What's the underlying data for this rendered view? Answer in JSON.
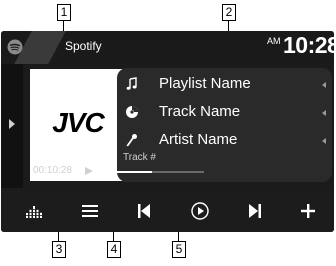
{
  "callouts": [
    "1",
    "2",
    "3",
    "4",
    "5"
  ],
  "header": {
    "source_icon": "spotify-icon",
    "source_label": "Spotify",
    "clock_ampm": "AM",
    "clock_time": "10:28"
  },
  "artwork": {
    "logo_text": "JVC"
  },
  "track_info": [
    {
      "icon": "music-note-icon",
      "text": "Playlist Name"
    },
    {
      "icon": "disc-icon",
      "text": "Track Name"
    },
    {
      "icon": "artist-icon",
      "text": "Artist Name"
    }
  ],
  "playback": {
    "track_label": "Track #",
    "elapsed": "00:10:28",
    "progress_fraction": 0.5
  },
  "controls": [
    {
      "icon": "equalizer-icon"
    },
    {
      "icon": "menu-icon"
    },
    {
      "icon": "previous-track-icon"
    },
    {
      "icon": "play-icon"
    },
    {
      "icon": "next-track-icon"
    },
    {
      "icon": "add-icon"
    }
  ],
  "colors": {
    "screen_bg": "#1b1b1b",
    "panel_bg": "#2a2a2a",
    "text": "#ffffff",
    "spotify_green": "#8a8a8a"
  }
}
